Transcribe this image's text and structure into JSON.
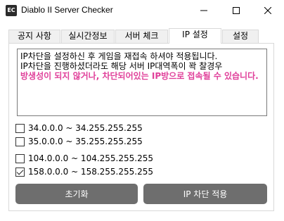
{
  "window": {
    "title": "Diablo II Server Checker",
    "icon_text": "EC",
    "controls": [
      "minimize-icon",
      "maximize-icon",
      "close-icon"
    ]
  },
  "tabs": [
    {
      "label": "공지 사항",
      "active": false
    },
    {
      "label": "실시간정보",
      "active": false
    },
    {
      "label": "서버 체크",
      "active": false
    },
    {
      "label": "IP 설정",
      "active": true
    },
    {
      "label": "설정",
      "active": false
    }
  ],
  "notice": {
    "line1": "IP차단을 설정하신 후 게임을 재접속 하셔야 적용됩니다.",
    "line2": "IP차단을 진행하셨더라도 해당 서버 IP대역폭이 꽉 찰경우",
    "warning": "방생성이 되지 않거나, 차단되어있는 IP방으로 접속될 수 있습니다.",
    "warning_color": "#e0409a"
  },
  "ip_ranges": [
    {
      "label": "34.0.0.0 ~ 34.255.255.255",
      "checked": false
    },
    {
      "label": "35.0.0.0 ~ 35.255.255.255",
      "checked": false
    },
    {
      "label": "104.0.0.0 ~ 104.255.255.255",
      "checked": false
    },
    {
      "label": "158.0.0.0 ~ 158.255.255.255",
      "checked": true
    }
  ],
  "buttons": {
    "reset_label": "초기화",
    "apply_label": "IP 차단 적용",
    "color": "#6e6e6e"
  }
}
